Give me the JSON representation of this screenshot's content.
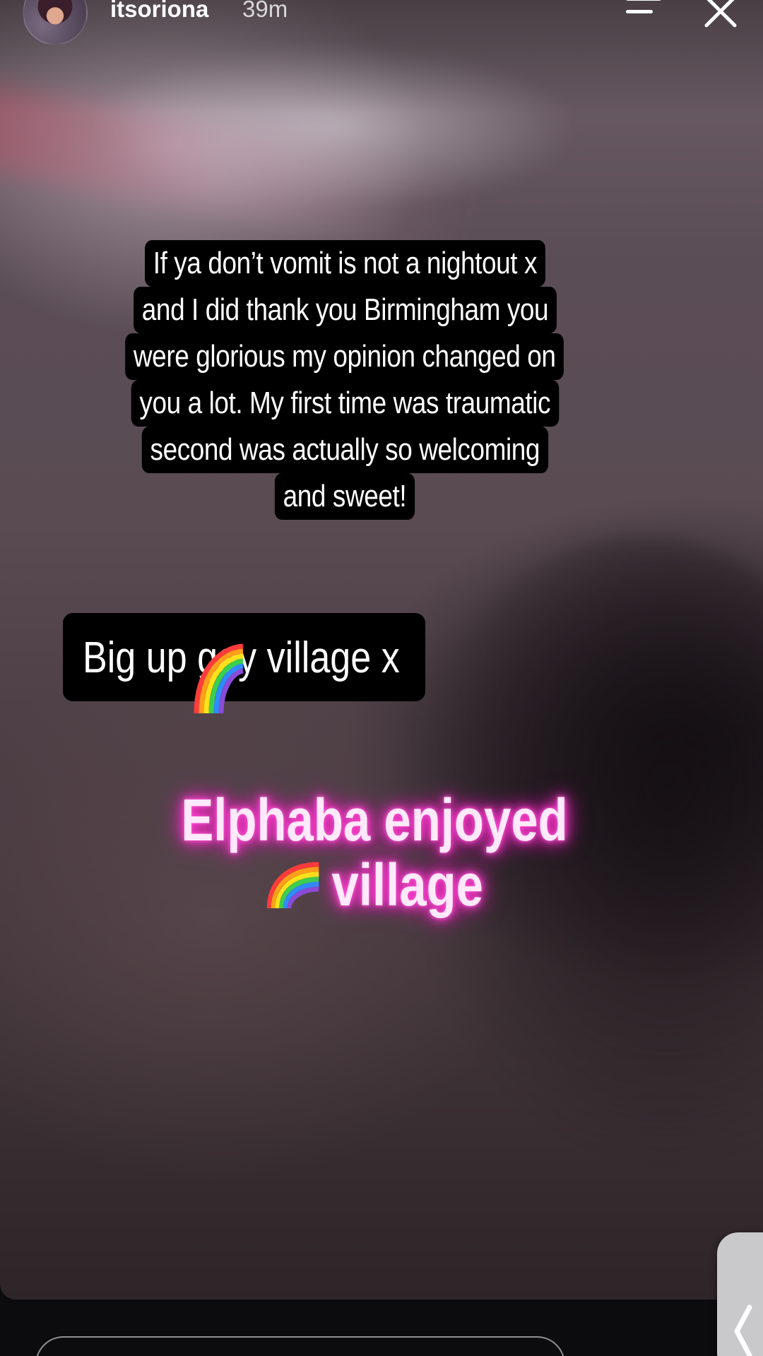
{
  "header": {
    "username": "itsoriona",
    "timestamp": "39m"
  },
  "icons": {
    "menu": "menu-lines-icon",
    "close": "close-icon",
    "sticker": "rainbow-emoji",
    "side_handle": "chevron-left-icon"
  },
  "caption": {
    "lines": [
      "If ya don’t vomit is not a nightout x",
      "and I did thank you Birmingham you",
      "were glorious my opinion changed on",
      "you a lot. My first time was traumatic",
      "second was actually so welcoming",
      "and sweet!"
    ]
  },
  "bigup": {
    "text": "Big up gay village x"
  },
  "neon": {
    "line1": "Elphaba enjoyed",
    "line2": "village"
  },
  "reply": {
    "placeholder": ""
  },
  "colors": {
    "neon_glow": "#ff2ec8",
    "caption_bg": "#000000",
    "caption_text": "#ffffff"
  }
}
